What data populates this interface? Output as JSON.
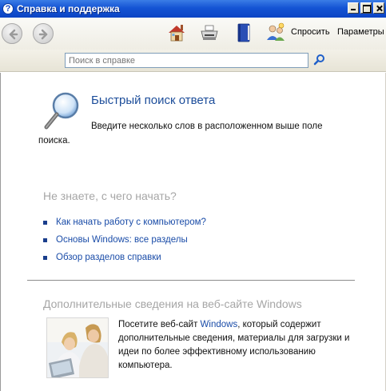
{
  "window": {
    "title": "Справка и поддержка",
    "icon": "help-question-icon"
  },
  "toolbar": {
    "back_icon": "back-arrow-icon",
    "forward_icon": "forward-arrow-icon",
    "home_icon": "home-icon",
    "print_icon": "printer-icon",
    "favorites_icon": "favorites-book-icon",
    "support_icon": "support-people-icon",
    "ask_label": "Спросить",
    "options_label": "Параметры"
  },
  "search": {
    "placeholder": "Поиск в справке",
    "value": "",
    "go_icon": "search-go-icon"
  },
  "quick": {
    "title": "Быстрый поиск ответа",
    "description": "Введите несколько слов в расположенном выше поле поиска."
  },
  "start": {
    "heading": "Не знаете, с чего начать?",
    "links": [
      "Как начать работу с компьютером?",
      "Основы Windows: все разделы",
      "Обзор разделов справки"
    ]
  },
  "web": {
    "heading": "Дополнительные сведения на веб-сайте Windows",
    "text_before": "Посетите веб-сайт ",
    "link": "Windows",
    "text_after": ", который содержит дополнительные сведения, материалы для загрузки и идеи по более эффективному использованию компьютера."
  },
  "colors": {
    "titlebar": "#0b44c4",
    "heading_blue": "#1c4d9a",
    "link_blue": "#1a4ca8",
    "muted_heading": "#a6a6a6"
  }
}
